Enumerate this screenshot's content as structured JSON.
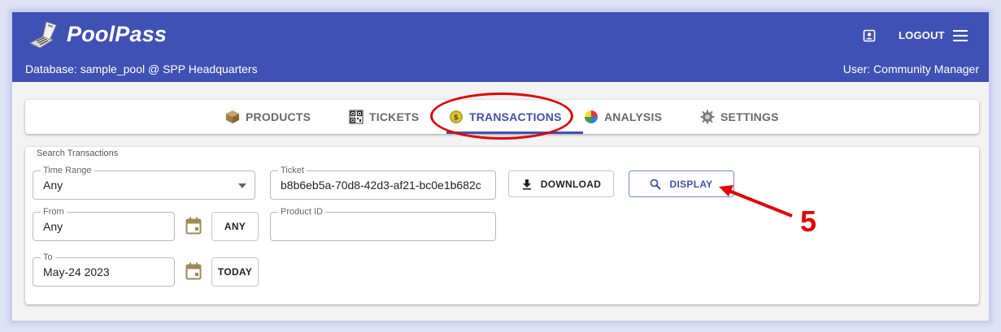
{
  "app": {
    "brand": "PoolPass",
    "database_line": "Database: sample_pool @ SPP Headquarters",
    "user_line": "User: Community Manager",
    "logout_label": "LOGOUT",
    "icons": {
      "logo": "ticket-scanner-logo-icon",
      "profile": "account-box-icon",
      "menu": "hamburger-menu-icon"
    }
  },
  "tabs": [
    {
      "label": "PRODUCTS",
      "icon": "box-icon",
      "active": false
    },
    {
      "label": "TICKETS",
      "icon": "qr-code-icon",
      "active": false
    },
    {
      "label": "TRANSACTIONS",
      "icon": "coin-icon",
      "active": true
    },
    {
      "label": "ANALYSIS",
      "icon": "color-wheel-icon",
      "active": false
    },
    {
      "label": "SETTINGS",
      "icon": "gear-icon",
      "active": false
    }
  ],
  "search": {
    "title": "Search Transactions",
    "time_range": {
      "label": "Time Range",
      "value": "Any"
    },
    "from": {
      "label": "From",
      "value": "Any",
      "button": "ANY"
    },
    "to": {
      "label": "To",
      "value": "May-24 2023",
      "button": "TODAY"
    },
    "ticket": {
      "label": "Ticket",
      "value": "b8b6eb5a-70d8-42d3-af21-bc0e1b682c"
    },
    "product_id": {
      "label": "Product ID",
      "value": ""
    },
    "download_label": "DOWNLOAD",
    "display_label": "DISPLAY"
  },
  "annotation": {
    "step_number": "5",
    "color": "#e60000"
  },
  "colors": {
    "primary": "#3f51b5",
    "annotation": "#e60000",
    "calendar": "#a0895a"
  }
}
